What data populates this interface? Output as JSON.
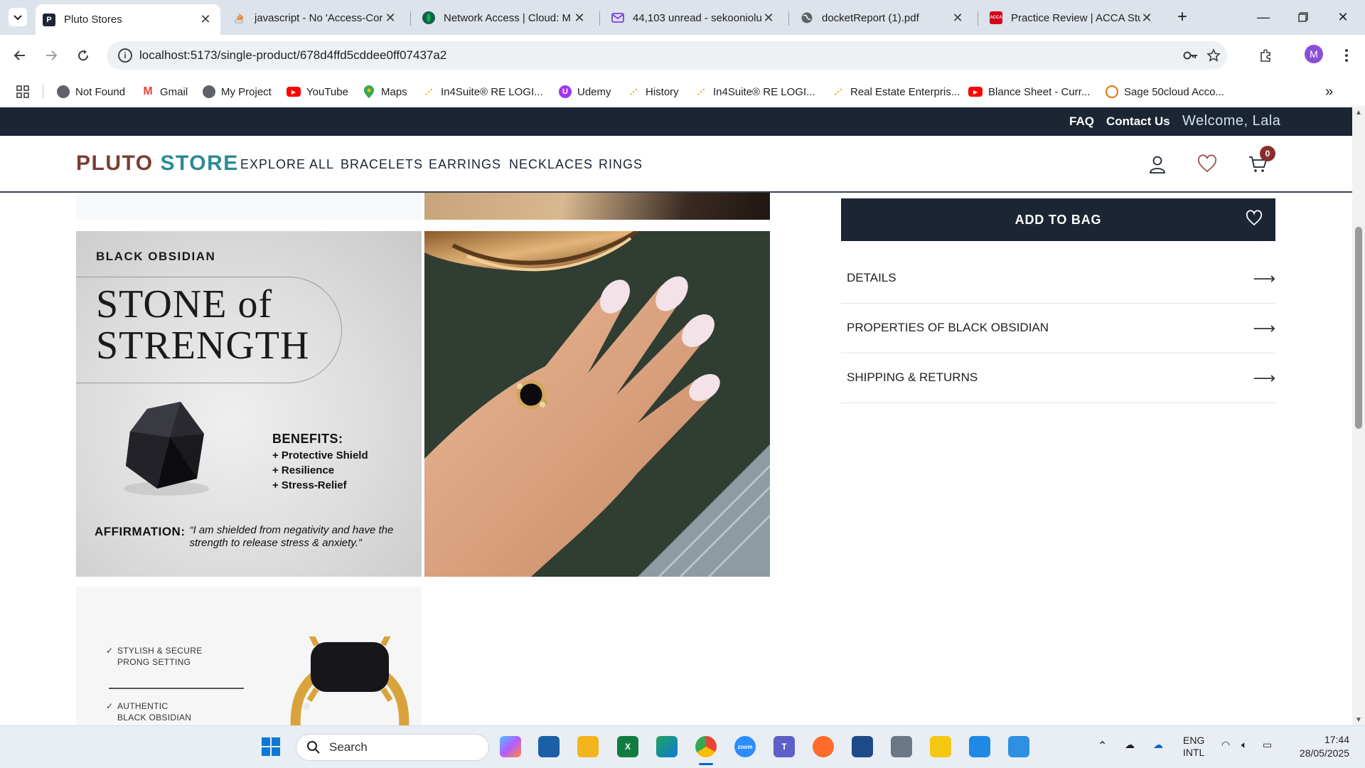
{
  "browser": {
    "tabs": [
      {
        "title": "Pluto Stores",
        "active": true,
        "favicon_color": "#1c2533",
        "favicon_letter": "P"
      },
      {
        "title": "javascript - No 'Access-Cor",
        "active": false,
        "favicon_color": "#f48024",
        "favicon_letter": ""
      },
      {
        "title": "Network Access | Cloud: M",
        "active": false,
        "favicon_color": "#116149",
        "favicon_letter": ""
      },
      {
        "title": "44,103 unread - sekooniolu",
        "active": false,
        "favicon_color": "#7b3fe4",
        "favicon_letter": ""
      },
      {
        "title": "docketReport (1).pdf",
        "active": false,
        "favicon_color": "#5f6368",
        "favicon_letter": ""
      },
      {
        "title": "Practice Review | ACCA Stu",
        "active": false,
        "favicon_color": "#d0021b",
        "favicon_letter": "ACCA"
      }
    ],
    "url": "localhost:5173/single-product/678d4ffd5cddee0ff07437a2",
    "profile_initial": "M",
    "bookmarks": [
      {
        "label": "Not Found",
        "color": "#5f6368",
        "icon": "globe-icon"
      },
      {
        "label": "Gmail",
        "color": "#ea4335",
        "icon": "gmail-icon"
      },
      {
        "label": "My Project",
        "color": "#5f6368",
        "icon": "globe-icon"
      },
      {
        "label": "YouTube",
        "color": "#ff0000",
        "icon": "youtube-icon"
      },
      {
        "label": "Maps",
        "color": "#34a853",
        "icon": "maps-icon"
      },
      {
        "label": "In4Suite® RE LOGI...",
        "color": "#f4a300",
        "icon": "in4suite-icon"
      },
      {
        "label": "Udemy",
        "color": "#a435f0",
        "icon": "udemy-icon"
      },
      {
        "label": "History",
        "color": "#f4a300",
        "icon": "in4suite-icon"
      },
      {
        "label": "In4Suite® RE LOGI...",
        "color": "#f4a300",
        "icon": "in4suite-icon"
      },
      {
        "label": "Real Estate Enterpris...",
        "color": "#f4a300",
        "icon": "in4suite-icon"
      },
      {
        "label": "Blance Sheet - Curr...",
        "color": "#ff0000",
        "icon": "youtube-icon"
      },
      {
        "label": "Sage 50cloud Acco...",
        "color": "#e8710a",
        "icon": "sage-icon"
      }
    ]
  },
  "site": {
    "topbar": {
      "faq": "FAQ",
      "contact": "Contact Us",
      "welcome": "Welcome, Lala"
    },
    "logo": {
      "part1": "PLUTO",
      "part2": "STORE"
    },
    "nav": [
      "EXPLORE ALL",
      "BRACELETS",
      "EARRINGS",
      "NECKLACES",
      "RINGS"
    ],
    "cart_count": "0",
    "obsidian_card": {
      "kicker": "BLACK OBSIDIAN",
      "title_line1": "STONE",
      "title_of": "of",
      "title_line2": "STRENGTH",
      "benefits_heading": "BENEFITS:",
      "benefits": [
        "+ Protective Shield",
        "+ Resilience",
        "+ Stress-Relief"
      ],
      "affirmation_label": "AFFIRMATION:",
      "affirmation_text": "“I am shielded from negativity and have the strength to release stress & anxiety.”"
    },
    "ring_card": {
      "note1_line1": "STYLISH & SECURE",
      "note1_line2": "PRONG SETTING",
      "note2_line1": "AUTHENTIC",
      "note2_line2": "BLACK OBSIDIAN"
    },
    "add_to_bag": "ADD TO BAG",
    "accordion": [
      {
        "label": "DETAILS"
      },
      {
        "label": "PROPERTIES OF BLACK OBSIDIAN"
      },
      {
        "label": "SHIPPING & RETURNS"
      }
    ]
  },
  "taskbar": {
    "search_placeholder": "Search",
    "lang_line1": "ENG",
    "lang_line2": "INTL",
    "time": "17:44",
    "date": "28/05/2025"
  }
}
